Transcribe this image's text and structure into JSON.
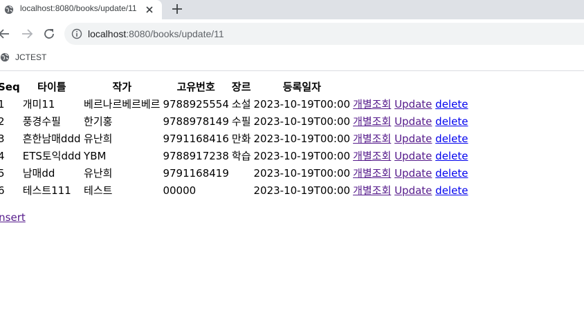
{
  "browser": {
    "tab_title": "localhost:8080/books/update/11",
    "url_host": "localhost",
    "url_rest": ":8080/books/update/11",
    "bookmark_label": "JCTEST"
  },
  "table": {
    "headers": [
      "Seq",
      "타이틀",
      "작가",
      "고유번호",
      "장르",
      "등록일자"
    ],
    "rows": [
      {
        "seq": "1",
        "title": "개미11",
        "author": "베르나르베르베르",
        "isbn": "9788925554",
        "genre": "소설",
        "date": "2023-10-19T00:00",
        "view": "개별조회",
        "update": "Update",
        "delete": "delete"
      },
      {
        "seq": "2",
        "title": "풍경수필",
        "author": "한기홍",
        "isbn": "9788978149",
        "genre": "수필",
        "date": "2023-10-19T00:00",
        "view": "개별조회",
        "update": "Update",
        "delete": "delete"
      },
      {
        "seq": "3",
        "title": "흔한남매ddd",
        "author": "유난희",
        "isbn": "9791168416",
        "genre": "만화",
        "date": "2023-10-19T00:00",
        "view": "개별조회",
        "update": "Update",
        "delete": "delete"
      },
      {
        "seq": "4",
        "title": "ETS토익ddd",
        "author": "YBM",
        "isbn": "9788917238",
        "genre": "학습",
        "date": "2023-10-19T00:00",
        "view": "개별조회",
        "update": "Update",
        "delete": "delete"
      },
      {
        "seq": "5",
        "title": "남매dd",
        "author": "유난희",
        "isbn": "9791168419",
        "genre": "",
        "date": "2023-10-19T00:00",
        "view": "개별조회",
        "update": "Update",
        "delete": "delete"
      },
      {
        "seq": "6",
        "title": "테스트111",
        "author": "테스트",
        "isbn": "00000",
        "genre": "",
        "date": "2023-10-19T00:00",
        "view": "개별조회",
        "update": "Update",
        "delete": "delete"
      }
    ]
  },
  "insert_label": "insert",
  "colors": {
    "link": "#0000ee",
    "visited_link": "#551a8b",
    "tabstrip": "#dee1e6",
    "omnibox": "#f1f3f4"
  }
}
